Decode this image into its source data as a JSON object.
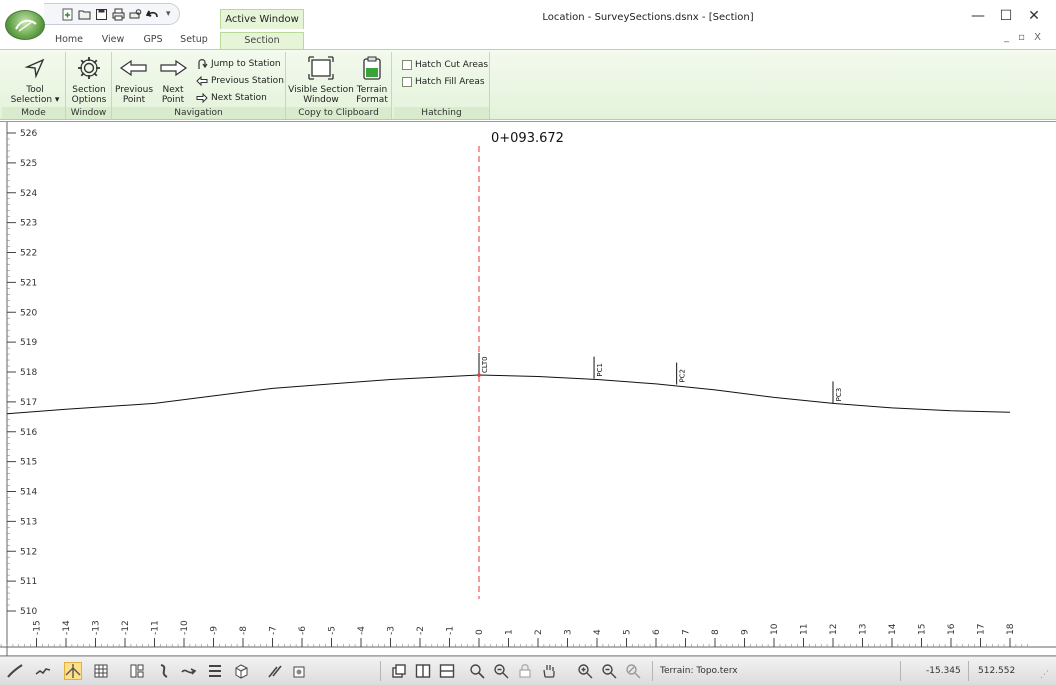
{
  "window": {
    "title": "Location - SurveySections.dsnx - [Section]",
    "context_tab": "Active Window",
    "qat_dropdown": "▾",
    "minimize": "—",
    "maximize": "☐",
    "close": "✕",
    "mdi_controls": "_ ▫ X"
  },
  "tabs": [
    {
      "label": "Home"
    },
    {
      "label": "View"
    },
    {
      "label": "GPS"
    },
    {
      "label": "Setup"
    },
    {
      "label": "Section",
      "active": true
    }
  ],
  "ribbon": {
    "groups": [
      {
        "label": "Mode"
      },
      {
        "label": "Window"
      },
      {
        "label": "Navigation"
      },
      {
        "label": "Copy to Clipboard"
      },
      {
        "label": "Hatching"
      }
    ],
    "tool_selection": [
      "Tool",
      "Selection ▾"
    ],
    "section_options": [
      "Section",
      "Options"
    ],
    "previous_point": [
      "Previous",
      "Point"
    ],
    "next_point": [
      "Next",
      "Point"
    ],
    "jump_to_station": "Jump to Station",
    "previous_station": "Previous Station",
    "next_station": "Next Station",
    "visible_section_window": [
      "Visible Section",
      "Window"
    ],
    "terrain_format": [
      "Terrain",
      "Format"
    ],
    "hatch_cut": "Hatch Cut Areas",
    "hatch_fill": "Hatch Fill Areas"
  },
  "section": {
    "station_label": "0+093.672",
    "y_ticks": [
      "526",
      "525",
      "524",
      "523",
      "522",
      "521",
      "520",
      "519",
      "518",
      "517",
      "516",
      "515",
      "514",
      "513",
      "512",
      "511",
      "510"
    ],
    "x_ticks": [
      "-15",
      "-14",
      "-13",
      "-12",
      "-11",
      "-10",
      "-9",
      "-8",
      "-7",
      "-6",
      "-5",
      "-4",
      "-3",
      "-2",
      "-1",
      "0",
      "1",
      "2",
      "3",
      "4",
      "5",
      "6",
      "7",
      "8",
      "9",
      "10",
      "11",
      "12",
      "13",
      "14",
      "15",
      "16",
      "17",
      "18"
    ],
    "ground_profile": [
      [
        -16,
        516.6
      ],
      [
        -14,
        516.75
      ],
      [
        -11,
        516.95
      ],
      [
        -9,
        517.2
      ],
      [
        -7,
        517.45
      ],
      [
        -5,
        517.6
      ],
      [
        -3,
        517.75
      ],
      [
        -1,
        517.85
      ],
      [
        0,
        517.9
      ],
      [
        2,
        517.85
      ],
      [
        4,
        517.75
      ],
      [
        6,
        517.6
      ],
      [
        8,
        517.4
      ],
      [
        10,
        517.15
      ],
      [
        12,
        516.95
      ],
      [
        14,
        516.8
      ],
      [
        16,
        516.7
      ],
      [
        18,
        516.65
      ]
    ],
    "point_labels": [
      {
        "text": "CLT0",
        "x": 0,
        "y": 517.9
      },
      {
        "text": "PC1",
        "x": 3.9,
        "y": 517.78
      },
      {
        "text": "PC2",
        "x": 6.7,
        "y": 517.58
      },
      {
        "text": "PC3",
        "x": 12,
        "y": 516.95
      }
    ]
  },
  "status": {
    "terrain": "Terrain: Topo.terx",
    "x_coord": "-15.345",
    "y_coord": "512.552"
  },
  "colors": {
    "ribbon_accent": "#e6f5d8",
    "centerline": "#e53935",
    "profile": "#111111"
  }
}
